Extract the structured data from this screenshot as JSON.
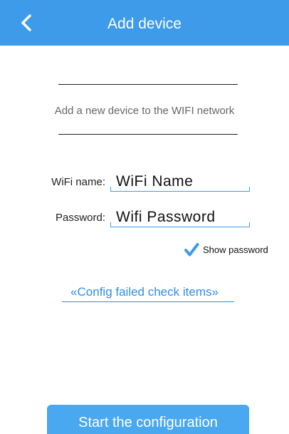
{
  "header": {
    "title": "Add device",
    "back_icon": "chevron-left-icon"
  },
  "intro": {
    "subtitle": "Add a new device to the WIFI network"
  },
  "form": {
    "wifi_name": {
      "label": "WiFi name:",
      "value": "WiFi Name"
    },
    "password": {
      "label": "Password:",
      "value": "Wifi Password"
    },
    "show_password": {
      "label": "Show password",
      "checked": true
    }
  },
  "config_failed_link": "«Config failed check items»",
  "start_button": "Start the configuration",
  "colors": {
    "accent": "#3d9be9",
    "button": "#49a8f0",
    "link": "#2e8fe0"
  }
}
